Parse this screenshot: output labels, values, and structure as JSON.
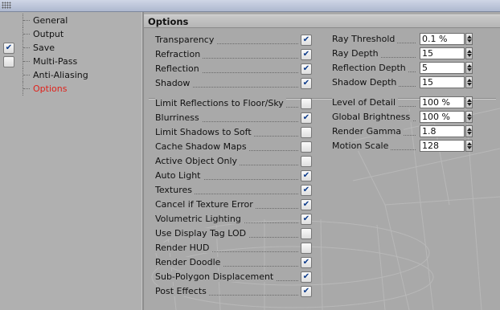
{
  "sidebar": {
    "items": [
      {
        "label": "General",
        "checkbox": null,
        "active": false
      },
      {
        "label": "Output",
        "checkbox": null,
        "active": false
      },
      {
        "label": "Save",
        "checkbox": true,
        "active": false
      },
      {
        "label": "Multi-Pass",
        "checkbox": false,
        "active": false
      },
      {
        "label": "Anti-Aliasing",
        "checkbox": null,
        "active": false
      },
      {
        "label": "Options",
        "checkbox": null,
        "active": true
      }
    ]
  },
  "panel": {
    "title": "Options",
    "top_checks": [
      {
        "label": "Transparency",
        "checked": true
      },
      {
        "label": "Refraction",
        "checked": true
      },
      {
        "label": "Reflection",
        "checked": true
      },
      {
        "label": "Shadow",
        "checked": true
      }
    ],
    "top_fields": [
      {
        "label": "Ray Threshold",
        "value": "0.1 %"
      },
      {
        "label": "Ray Depth",
        "value": "15"
      },
      {
        "label": "Reflection Depth",
        "value": "5"
      },
      {
        "label": "Shadow Depth",
        "value": "15"
      }
    ],
    "bottom_checks": [
      {
        "label": "Limit Reflections to Floor/Sky",
        "checked": false
      },
      {
        "label": "Blurriness",
        "checked": true
      },
      {
        "label": "Limit Shadows to Soft",
        "checked": false
      },
      {
        "label": "Cache Shadow Maps",
        "checked": false
      },
      {
        "label": "Active Object Only",
        "checked": false
      },
      {
        "label": "Auto Light",
        "checked": true
      },
      {
        "label": "Textures",
        "checked": true
      },
      {
        "label": "Cancel if Texture Error",
        "checked": true
      },
      {
        "label": "Volumetric Lighting",
        "checked": true
      },
      {
        "label": "Use Display Tag LOD",
        "checked": false
      },
      {
        "label": "Render HUD",
        "checked": false
      },
      {
        "label": "Render Doodle",
        "checked": true
      },
      {
        "label": "Sub-Polygon Displacement",
        "checked": true
      },
      {
        "label": "Post Effects",
        "checked": true
      }
    ],
    "bottom_fields": [
      {
        "label": "Level of Detail",
        "value": "100 %"
      },
      {
        "label": "Global Brightness",
        "value": "100 %"
      },
      {
        "label": "Render Gamma",
        "value": "1.8"
      },
      {
        "label": "Motion Scale",
        "value": "128"
      }
    ]
  },
  "icons": {
    "checkmark": "✔",
    "grip": "window-grip-icon",
    "spinner": "spinner-arrows-icon"
  },
  "colors": {
    "active_item": "#e0221b",
    "check": "#0b3a8a"
  }
}
